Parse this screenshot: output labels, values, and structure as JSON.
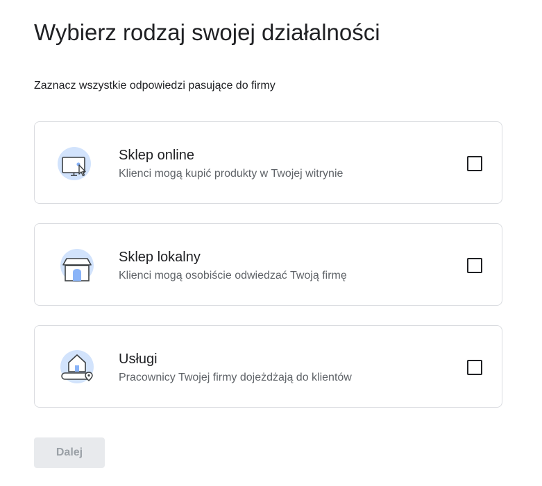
{
  "page": {
    "title": "Wybierz rodzaj swojej działalności",
    "subtitle": "Zaznacz wszystkie odpowiedzi pasujące do firmy"
  },
  "options": [
    {
      "title": "Sklep online",
      "description": "Klienci mogą kupić produkty w Twojej witrynie",
      "icon": "online-store-icon",
      "checked": false
    },
    {
      "title": "Sklep lokalny",
      "description": "Klienci mogą osobiście odwiedzać Twoją firmę",
      "icon": "local-store-icon",
      "checked": false
    },
    {
      "title": "Usługi",
      "description": "Pracownicy Twojej firmy dojeżdżają do klientów",
      "icon": "service-area-icon",
      "checked": false
    }
  ],
  "footer": {
    "next_label": "Dalej",
    "next_enabled": false
  },
  "colors": {
    "icon_circle": "#d2e3fc",
    "icon_accent": "#8ab4f8",
    "icon_line": "#3c4043",
    "card_border": "#dadce0",
    "button_disabled_bg": "#e8eaed",
    "button_disabled_text": "#9aa0a6"
  }
}
